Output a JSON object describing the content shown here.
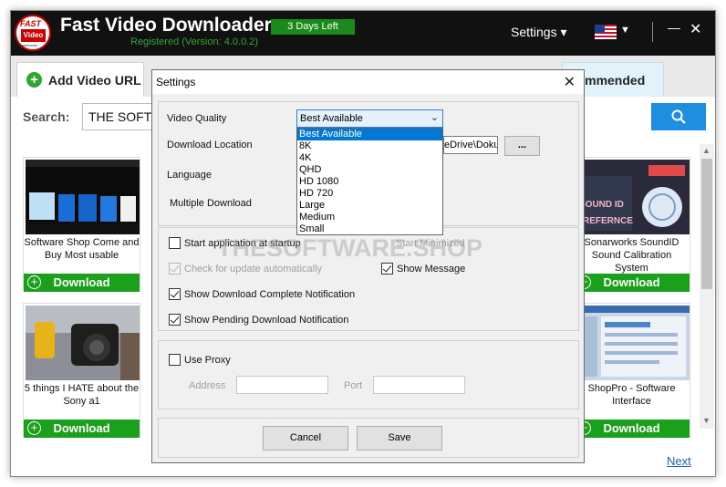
{
  "app": {
    "logo_text_top": "FAST",
    "logo_text_mid": "Video",
    "logo_text_bottom": "Downloader",
    "title": "Fast Video Downloader",
    "days_left": "3 Days Left",
    "registered": "Registered (Version: 4.0.0.2)",
    "settings_menu": "Settings ▾",
    "minimize_glyph": "—",
    "close_glyph": "✕"
  },
  "tabs": {
    "add_video": "Add Video URL",
    "recommended": "ecommended"
  },
  "search": {
    "label": "Search:",
    "value": "THE SOFT"
  },
  "cards": [
    {
      "title": "Software Shop Come and Buy Most usable",
      "download": "Download"
    },
    {
      "title": "Sonarworks SoundID Sound Calibration System",
      "download": "Download"
    },
    {
      "title": "5 things I HATE about the Sony a1",
      "download": "Download"
    },
    {
      "title": "ShopPro - Software Interface",
      "download": "Download"
    }
  ],
  "next": "Next",
  "watermark": "THESOFTWARE.SHOP",
  "settings_dialog": {
    "title": "Settings",
    "close": "✕",
    "video_quality_label": "Video Quality",
    "video_quality_value": "Best Available",
    "quality_options": [
      "Best Available",
      "8K",
      "4K",
      "QHD",
      "HD 1080",
      "HD 720",
      "Large",
      "Medium",
      "Small"
    ],
    "download_location_label": "Download Location",
    "download_location_value": "eDrive\\Doku",
    "browse_label": "...",
    "language_label": "Language",
    "multiple_download_label": "Multiple Download",
    "start_at_startup": "Start application at startup",
    "start_minimized": "Start Minimized",
    "check_update": "Check for update automatically",
    "show_message": "Show Message",
    "show_download_complete": "Show Download Complete Notification",
    "show_pending": "Show Pending Download Notification",
    "use_proxy": "Use Proxy",
    "address_label": "Address",
    "port_label": "Port",
    "cancel": "Cancel",
    "save": "Save"
  }
}
